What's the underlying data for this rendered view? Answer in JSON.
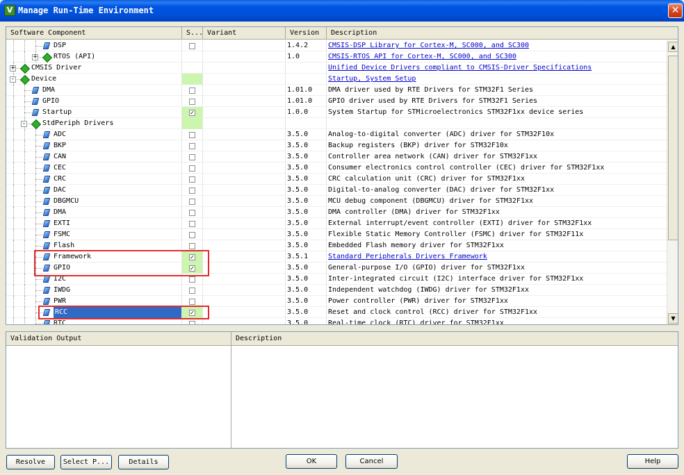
{
  "window": {
    "title": "Manage Run-Time Environment",
    "icon_letter": "V",
    "close_glyph": "✕"
  },
  "grid": {
    "columns": [
      "Software Component",
      "S...",
      "Variant",
      "Version",
      "Description"
    ],
    "rows": [
      {
        "name": "DSP",
        "level": 2,
        "icon": "gem",
        "check": "unchecked",
        "sel_green": false,
        "version": "1.4.2",
        "description": "CMSIS-DSP Library for Cortex-M, SC000, and SC300",
        "link": true
      },
      {
        "name": "RTOS (API)",
        "level": 2,
        "icon": "diamond",
        "expander": "+",
        "check": "",
        "sel_green": false,
        "version": "1.0",
        "description": "CMSIS-RTOS API for Cortex-M, SC000, and SC300",
        "link": true
      },
      {
        "name": "CMSIS Driver",
        "level": 0,
        "icon": "diamond",
        "expander": "+",
        "check": "",
        "sel_green": false,
        "version": "",
        "description": "Unified Device Drivers compliant to CMSIS-Driver Specifications",
        "link": true
      },
      {
        "name": "Device",
        "level": 0,
        "icon": "diamond",
        "expander": "-",
        "check": "",
        "sel_green": true,
        "version": "",
        "description": "Startup, System Setup",
        "link": true
      },
      {
        "name": "DMA",
        "level": 1,
        "icon": "gem",
        "check": "unchecked",
        "sel_green": false,
        "version": "1.01.0",
        "description": "DMA driver used by RTE Drivers for STM32F1 Series",
        "link": false
      },
      {
        "name": "GPIO",
        "level": 1,
        "icon": "gem",
        "check": "unchecked",
        "sel_green": false,
        "version": "1.01.0",
        "description": "GPIO driver used by RTE Drivers for STM32F1 Series",
        "link": false
      },
      {
        "name": "Startup",
        "level": 1,
        "icon": "gem",
        "check": "checked",
        "sel_green": true,
        "version": "1.0.0",
        "description": "System Startup for STMicroelectronics STM32F1xx device series",
        "link": false
      },
      {
        "name": "StdPeriph Drivers",
        "level": 1,
        "icon": "diamond",
        "expander": "-",
        "check": "",
        "sel_green": true,
        "version": "",
        "description": "",
        "link": false
      },
      {
        "name": "ADC",
        "level": 2,
        "icon": "gem",
        "check": "unchecked",
        "sel_green": false,
        "version": "3.5.0",
        "description": "Analog-to-digital converter (ADC) driver for STM32F10x",
        "link": false
      },
      {
        "name": "BKP",
        "level": 2,
        "icon": "gem",
        "check": "unchecked",
        "sel_green": false,
        "version": "3.5.0",
        "description": "Backup registers (BKP) driver for STM32F10x",
        "link": false
      },
      {
        "name": "CAN",
        "level": 2,
        "icon": "gem",
        "check": "unchecked",
        "sel_green": false,
        "version": "3.5.0",
        "description": "Controller area network (CAN) driver for STM32F1xx",
        "link": false
      },
      {
        "name": "CEC",
        "level": 2,
        "icon": "gem",
        "check": "unchecked",
        "sel_green": false,
        "version": "3.5.0",
        "description": "Consumer electronics control controller (CEC) driver for STM32F1xx",
        "link": false
      },
      {
        "name": "CRC",
        "level": 2,
        "icon": "gem",
        "check": "unchecked",
        "sel_green": false,
        "version": "3.5.0",
        "description": "CRC calculation unit (CRC) driver for STM32F1xx",
        "link": false
      },
      {
        "name": "DAC",
        "level": 2,
        "icon": "gem",
        "check": "unchecked",
        "sel_green": false,
        "version": "3.5.0",
        "description": "Digital-to-analog converter (DAC) driver for STM32F1xx",
        "link": false
      },
      {
        "name": "DBGMCU",
        "level": 2,
        "icon": "gem",
        "check": "unchecked",
        "sel_green": false,
        "version": "3.5.0",
        "description": "MCU debug component (DBGMCU) driver for STM32F1xx",
        "link": false
      },
      {
        "name": "DMA",
        "level": 2,
        "icon": "gem",
        "check": "unchecked",
        "sel_green": false,
        "version": "3.5.0",
        "description": "DMA controller (DMA) driver for STM32F1xx",
        "link": false
      },
      {
        "name": "EXTI",
        "level": 2,
        "icon": "gem",
        "check": "unchecked",
        "sel_green": false,
        "version": "3.5.0",
        "description": "External interrupt/event controller (EXTI) driver for STM32F1xx",
        "link": false
      },
      {
        "name": "FSMC",
        "level": 2,
        "icon": "gem",
        "check": "unchecked",
        "sel_green": false,
        "version": "3.5.0",
        "description": "Flexible Static Memory Controller (FSMC) driver for STM32F11x",
        "link": false
      },
      {
        "name": "Flash",
        "level": 2,
        "icon": "gem",
        "check": "unchecked",
        "sel_green": false,
        "version": "3.5.0",
        "description": "Embedded Flash memory driver for STM32F1xx",
        "link": false
      },
      {
        "name": "Framework",
        "level": 2,
        "icon": "gem",
        "check": "checked",
        "sel_green": true,
        "version": "3.5.1",
        "description": "Standard Peripherals Drivers Framework",
        "link": true
      },
      {
        "name": "GPIO",
        "level": 2,
        "icon": "gem",
        "check": "checked",
        "sel_green": true,
        "version": "3.5.0",
        "description": "General-purpose I/O (GPIO) driver for STM32F1xx",
        "link": false
      },
      {
        "name": "I2C",
        "level": 2,
        "icon": "gem",
        "check": "unchecked",
        "sel_green": false,
        "version": "3.5.0",
        "description": "Inter-integrated circuit (I2C) interface driver for STM32F1xx",
        "link": false
      },
      {
        "name": "IWDG",
        "level": 2,
        "icon": "gem",
        "check": "unchecked",
        "sel_green": false,
        "version": "3.5.0",
        "description": "Independent watchdog (IWDG) driver for STM32F1xx",
        "link": false
      },
      {
        "name": "PWR",
        "level": 2,
        "icon": "gem",
        "check": "unchecked",
        "sel_green": false,
        "version": "3.5.0",
        "description": "Power controller (PWR) driver for STM32F1xx",
        "link": false
      },
      {
        "name": "RCC",
        "level": 2,
        "icon": "gem",
        "check": "checked",
        "sel_green": true,
        "selected": true,
        "version": "3.5.0",
        "description": "Reset and clock control (RCC) driver for STM32F1xx",
        "link": false
      },
      {
        "name": "RTC",
        "level": 2,
        "icon": "gem",
        "check": "unchecked",
        "sel_green": false,
        "version": "3.5.0",
        "description": "Real-time clock (RTC) driver for STM32F1xx",
        "link": false
      }
    ],
    "scroll_up_glyph": "▲",
    "scroll_down_glyph": "▼"
  },
  "validation": {
    "columns": [
      "Validation Output",
      "Description"
    ]
  },
  "buttons": {
    "resolve": "Resolve",
    "select": "Select P...",
    "details": "Details",
    "ok": "OK",
    "cancel": "Cancel",
    "help": "Help"
  },
  "colors": {
    "highlight": "#e12b2b",
    "selection": "#316ac5",
    "selected_green": "#ccf5b0",
    "link": "#0000cc"
  }
}
